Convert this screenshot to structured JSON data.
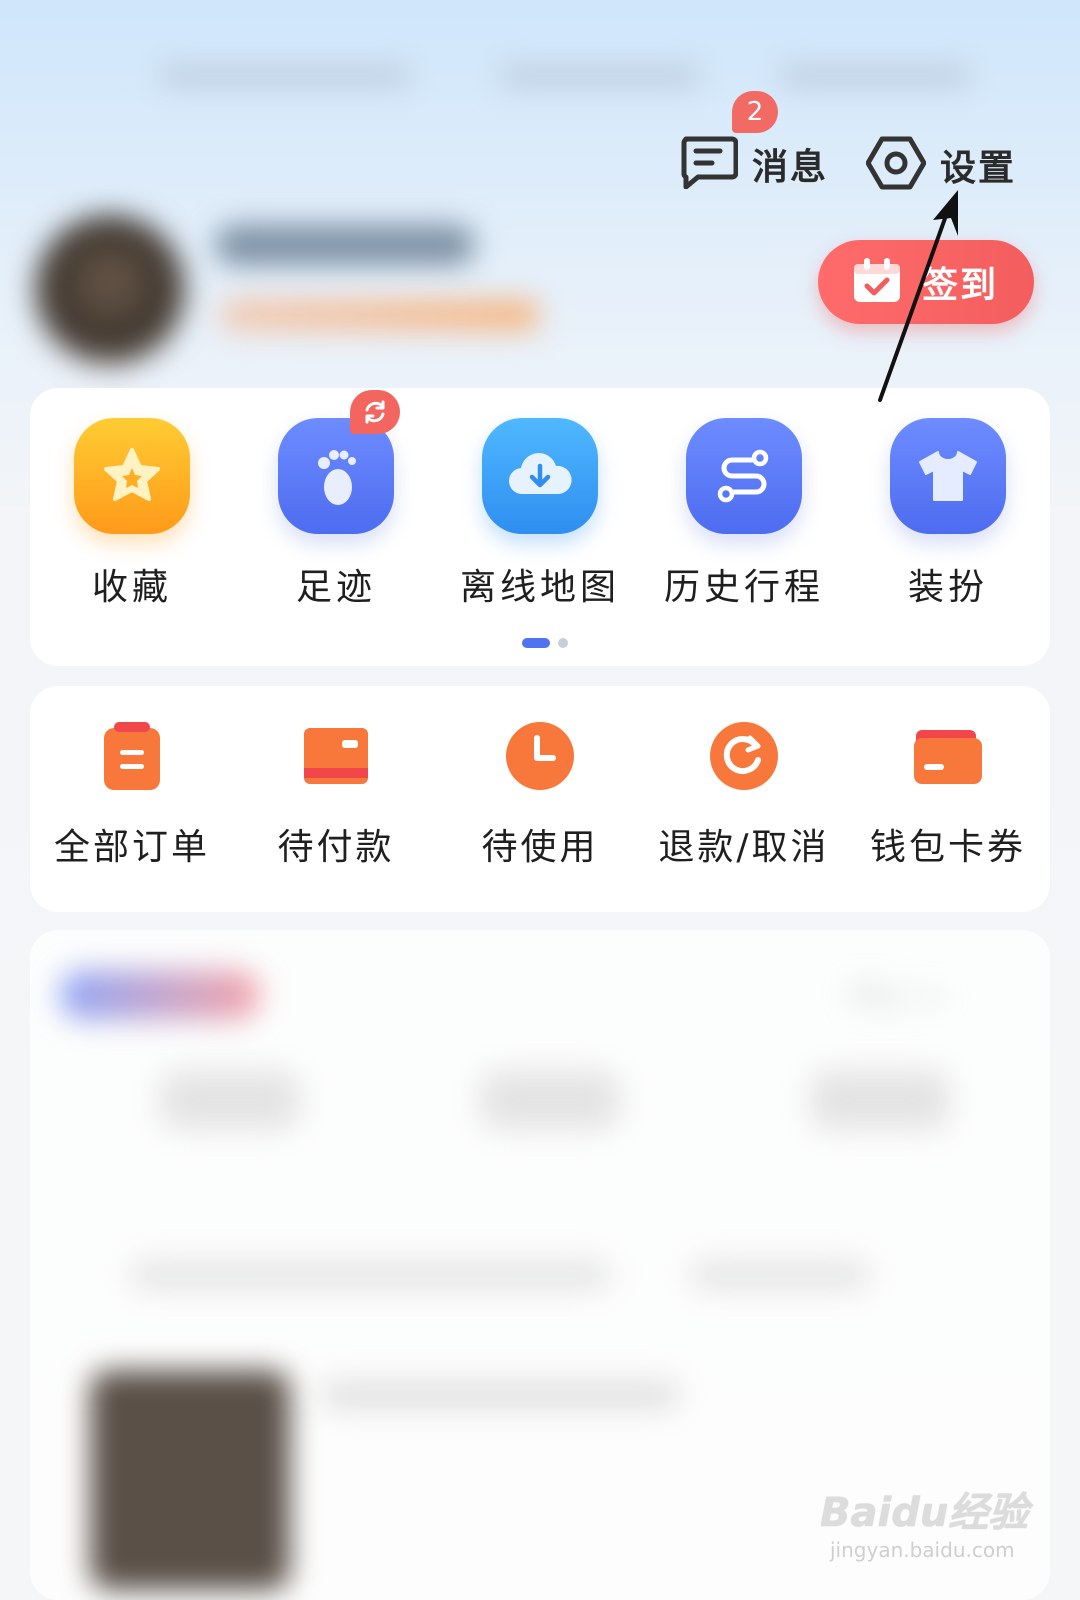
{
  "header": {
    "messages_label": "消息",
    "messages_badge": "2",
    "settings_label": "设置"
  },
  "checkin": {
    "label": "签到"
  },
  "tools": [
    {
      "label": "收藏",
      "icon": "star-icon"
    },
    {
      "label": "足迹",
      "icon": "footprint-icon"
    },
    {
      "label": "离线地图",
      "icon": "cloud-download-icon"
    },
    {
      "label": "历史行程",
      "icon": "route-icon"
    },
    {
      "label": "装扮",
      "icon": "tshirt-icon"
    }
  ],
  "pagination": {
    "pages": 2,
    "active": 1
  },
  "orders": [
    {
      "label": "全部订单",
      "icon": "clipboard-icon"
    },
    {
      "label": "待付款",
      "icon": "card-icon"
    },
    {
      "label": "待使用",
      "icon": "clock-icon"
    },
    {
      "label": "退款/取消",
      "icon": "refund-icon"
    },
    {
      "label": "钱包卡券",
      "icon": "wallet-icon"
    }
  ],
  "blurred_section": {
    "link_label": "中心 >"
  },
  "watermark": {
    "brand": "Baidu经验",
    "url": "jingyan.baidu.com"
  },
  "colors": {
    "accent_blue": "#4e74f0",
    "checkin_red": "#f35d5d",
    "order_orange": "#f8773a",
    "star_orange": "#fdb22a"
  }
}
